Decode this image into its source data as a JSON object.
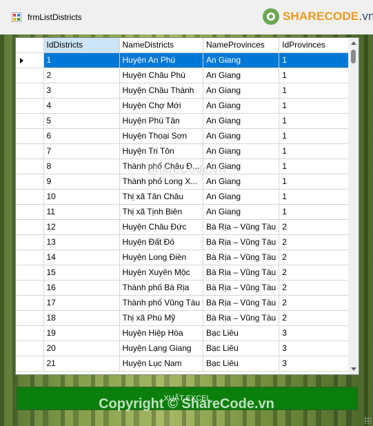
{
  "window": {
    "title": "frmListDistricts",
    "logo_text_a": "SHARECODE",
    "logo_text_b": ".vn"
  },
  "grid": {
    "columns": [
      "IdDistricts",
      "NameDistricts",
      "NameProvinces",
      "IdProvinces"
    ],
    "selected_row": 0,
    "rows": [
      [
        "1",
        "Huyện An Phú",
        "An Giang",
        "1"
      ],
      [
        "2",
        "Huyện Châu Phú",
        "An Giang",
        "1"
      ],
      [
        "3",
        "Huyện Châu Thành",
        "An Giang",
        "1"
      ],
      [
        "4",
        "Huyện Chợ Mới",
        "An Giang",
        "1"
      ],
      [
        "5",
        "Huyện Phú Tân",
        "An Giang",
        "1"
      ],
      [
        "6",
        "Huyện Thoại Sơn",
        "An Giang",
        "1"
      ],
      [
        "7",
        "Huyện Tri Tôn",
        "An Giang",
        "1"
      ],
      [
        "8",
        "Thành phố Châu Đ...",
        "An Giang",
        "1"
      ],
      [
        "9",
        "Thành phố Long X...",
        "An Giang",
        "1"
      ],
      [
        "10",
        "Thị xã Tân Châu",
        "An Giang",
        "1"
      ],
      [
        "11",
        "Thị xã Tịnh Biên",
        "An Giang",
        "1"
      ],
      [
        "12",
        "Huyện Châu Đức",
        "Bà Rịa – Vũng Tàu",
        "2"
      ],
      [
        "13",
        "Huyện Đất Đỏ",
        "Bà Rịa – Vũng Tàu",
        "2"
      ],
      [
        "14",
        "Huyện Long Điền",
        "Bà Rịa – Vũng Tàu",
        "2"
      ],
      [
        "15",
        "Huyện Xuyên Mộc",
        "Bà Rịa – Vũng Tàu",
        "2"
      ],
      [
        "16",
        "Thành phố Bà Rịa",
        "Bà Rịa – Vũng Tàu",
        "2"
      ],
      [
        "17",
        "Thành phố Vũng Tàu",
        "Bà Rịa – Vũng Tàu",
        "2"
      ],
      [
        "18",
        "Thị xã Phú Mỹ",
        "Bà Rịa – Vũng Tàu",
        "2"
      ],
      [
        "19",
        "Huyện Hiệp Hòa",
        "Bạc Liêu",
        "3"
      ],
      [
        "20",
        "Huyện Lạng Giang",
        "Bạc Liêu",
        "3"
      ],
      [
        "21",
        "Huyện Lục Nam",
        "Bạc Liêu",
        "3"
      ]
    ]
  },
  "actions": {
    "export_label": "XUẤT EXCEL"
  },
  "watermarks": {
    "middle": "ShareCode.vn",
    "bottom": "Copyright © ShareCode.vn"
  },
  "colors": {
    "selection": "#0078d7",
    "header_selected": "#cce4f7",
    "export_button": "#0b7f0b",
    "logo_orange": "#f29a1d",
    "logo_navy": "#2e4d6b"
  }
}
